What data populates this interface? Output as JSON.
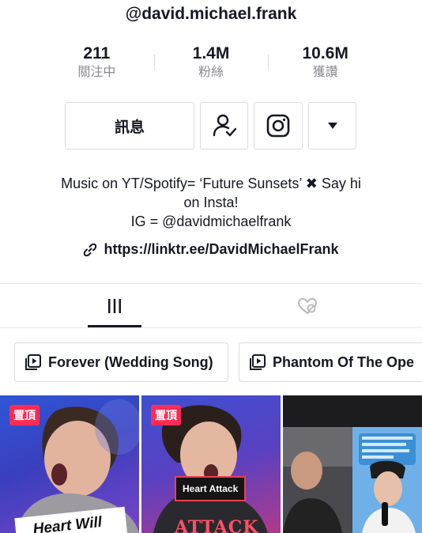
{
  "profile": {
    "handle": "@david.michael.frank",
    "stats": [
      {
        "value": "211",
        "label": "關注中"
      },
      {
        "value": "1.4M",
        "label": "粉絲"
      },
      {
        "value": "10.6M",
        "label": "獲讚"
      }
    ],
    "message_label": "訊息",
    "bio_line1": "Music on YT/Spotify= ‘Future Sunsets’ ✖ Say hi",
    "bio_line2": "on Insta!",
    "bio_line3": "IG = @davidmichaelfrank",
    "link": "https://linktr.ee/DavidMichaelFrank"
  },
  "icons": {
    "friend": "person-check-icon",
    "instagram": "instagram-icon",
    "more": "caret-down-icon",
    "link": "link-icon",
    "videos_tab": "grid-bars-icon",
    "liked_tab": "hidden-heart-icon",
    "playlist": "playlist-icon"
  },
  "playlists": [
    {
      "title": "Forever (Wedding Song)"
    },
    {
      "title": "Phantom Of The Ope"
    }
  ],
  "videos": [
    {
      "pinned_label": "置頂",
      "caption": "Heart Will"
    },
    {
      "pinned_label": "置頂",
      "caption": "Heart Attack",
      "overlay": "ATTACK"
    },
    {
      "caption": ""
    }
  ],
  "colors": {
    "accent": "#fe2c55",
    "text": "#161823",
    "muted": "#8a8b91"
  }
}
